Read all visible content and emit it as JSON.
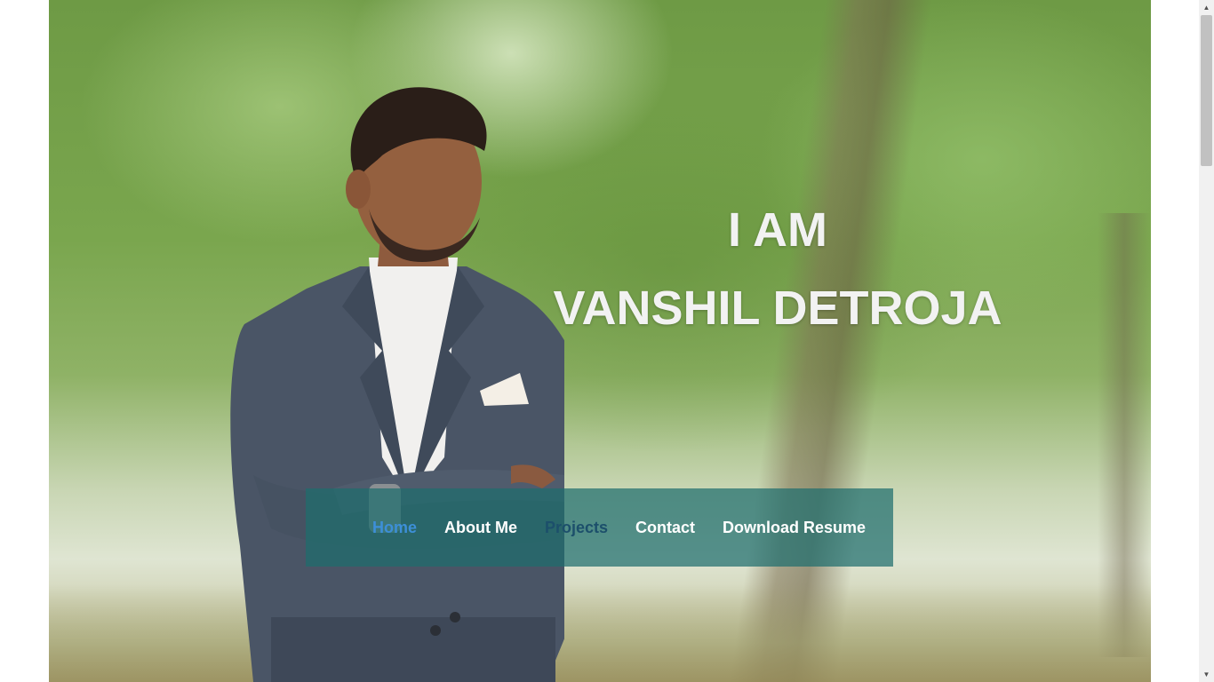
{
  "hero": {
    "line1": "I AM",
    "line2": "VANSHIL DETROJA"
  },
  "nav": {
    "items": [
      {
        "label": "Home",
        "state": "active"
      },
      {
        "label": "About Me",
        "state": "normal"
      },
      {
        "label": "Projects",
        "state": "dim"
      },
      {
        "label": "Contact",
        "state": "normal"
      },
      {
        "label": "Download Resume",
        "state": "normal"
      }
    ]
  },
  "colors": {
    "nav_background": "#1e6e6e",
    "nav_active": "#3d8fd8",
    "nav_text": "#ffffff",
    "heading_text": "#f2f2f2"
  },
  "icons": {
    "scroll_up": "scroll-up-arrow-icon",
    "scroll_down": "scroll-down-arrow-icon"
  }
}
